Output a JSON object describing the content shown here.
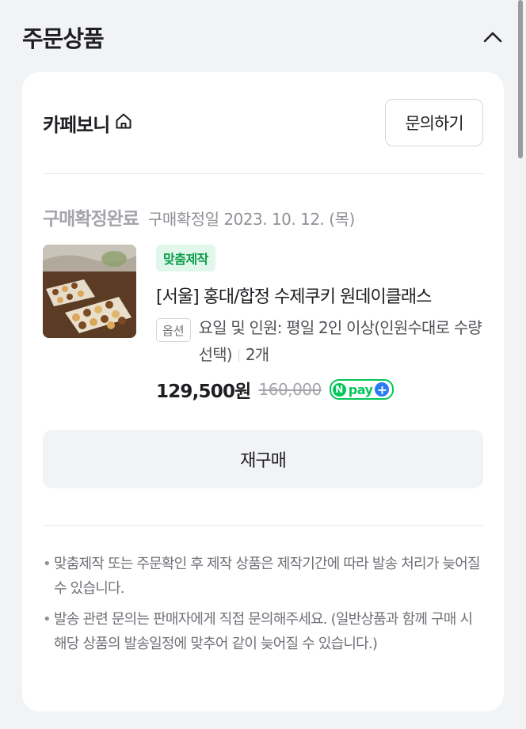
{
  "section": {
    "title": "주문상품",
    "collapse_icon": "chevron-up-icon"
  },
  "seller": {
    "name": "카페보니",
    "home_icon": "home-icon",
    "inquiry_label": "문의하기"
  },
  "order": {
    "status": "구매확정완료",
    "status_date": "구매확정일 2023. 10. 12. (목)"
  },
  "product": {
    "badge": "맞춤제작",
    "name": "[서울] 홍대/합정 수제쿠키 원데이클래스",
    "option_tag": "옵션",
    "option_text": "요일 및 인원: 평일 2인 이상(인원수대로 수량 선택)",
    "quantity": "2개",
    "price": "129,500원",
    "original_price": "160,000",
    "pay_badge": {
      "n": "N",
      "text": "pay",
      "plus": "+"
    }
  },
  "rebuy_label": "재구매",
  "notices": [
    "맞춤제작 또는 주문확인 후 제작 상품은 제작기간에 따라 발송 처리가 늦어질 수 있습니다.",
    "발송 관련 문의는 판매자에게 직접 문의해주세요. (일반상품과 함께 구매 시 해당 상품의 발송일정에 맞추어 같이 늦어질 수 있습니다.)"
  ],
  "colors": {
    "badge_bg": "#e2f7eb",
    "badge_text": "#0b9c4a",
    "npay_green": "#03c75a",
    "npay_blue": "#2b7bf5",
    "page_bg": "#f2f3f5"
  }
}
